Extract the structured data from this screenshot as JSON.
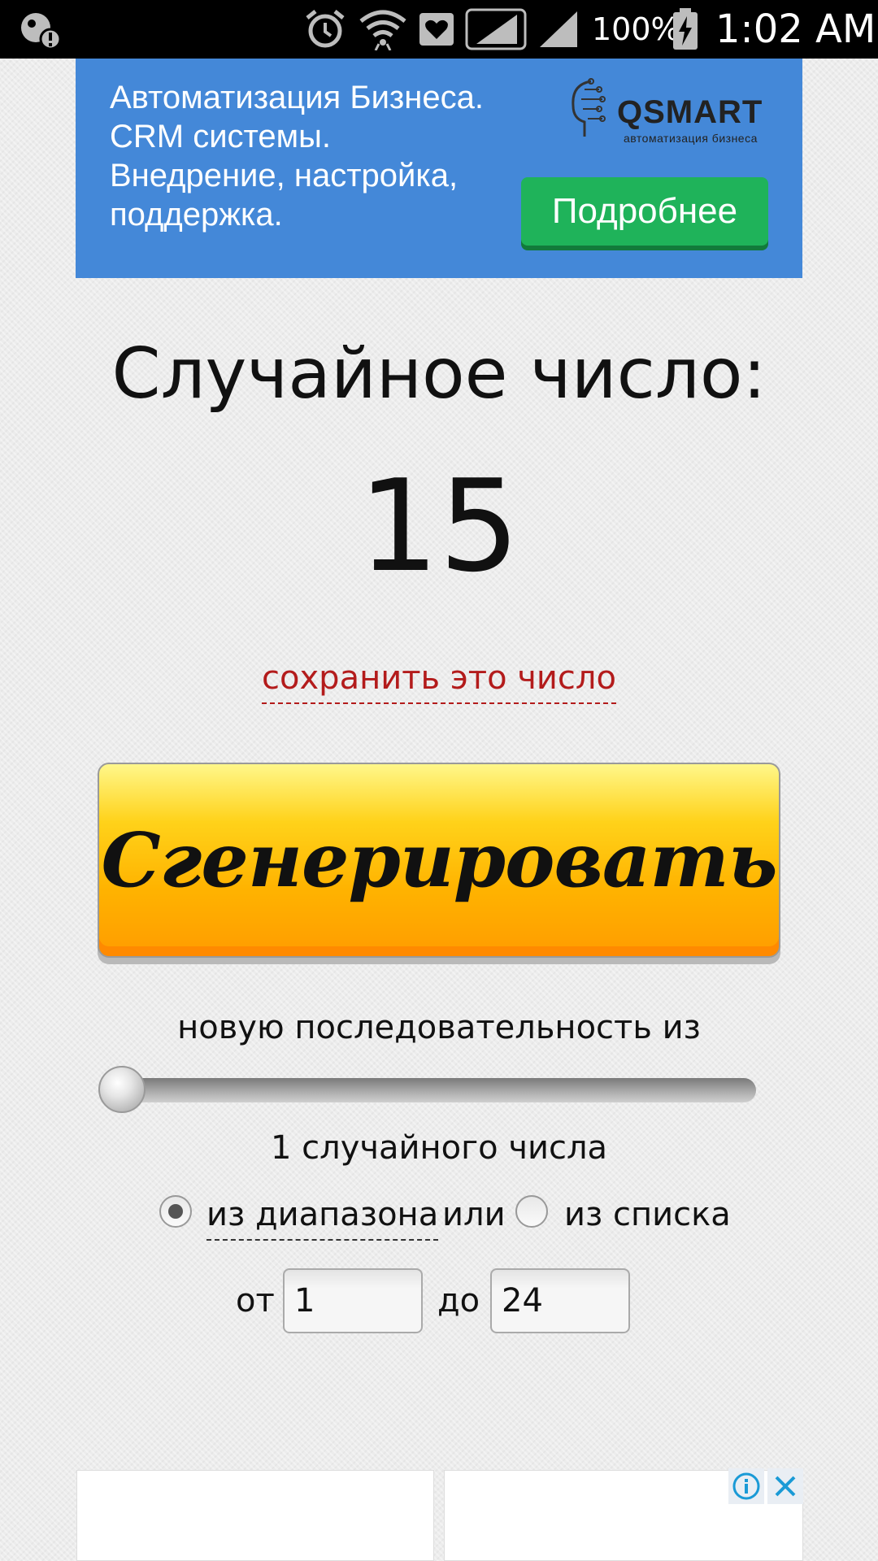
{
  "status_bar": {
    "battery_percent": "100%",
    "time": "1:02 AM",
    "icons": [
      "location-alert-icon",
      "alarm-icon",
      "wifi-icon",
      "health-icon",
      "signal-icon",
      "signal-icon",
      "battery-charging-icon"
    ]
  },
  "ad_banner": {
    "text": "Автоматизация Бизнеса. CRM системы. Внедрение, настройка, поддержка.",
    "logo_name": "QSMART",
    "logo_tagline": "автоматизация бизнеса",
    "cta_label": "Подробнее",
    "background": "#4488d8",
    "cta_color": "#1fb35a"
  },
  "main": {
    "title": "Случайное число:",
    "number": "15",
    "save_link": "сохранить это число",
    "generate_label": "Сгенерировать",
    "sequence_label": "новую последовательность из",
    "slider_value": 1,
    "count_label": "1 случайного числа",
    "mode": {
      "range_label": "из диапазона",
      "or_text": "или",
      "list_label": "из списка",
      "selected": "range"
    },
    "range": {
      "from_label": "от",
      "from_value": "1",
      "to_label": "до",
      "to_value": "24"
    }
  },
  "bottom_ad": {
    "icons": [
      "info-icon",
      "close-icon"
    ]
  },
  "colors": {
    "link": "#b31b1b",
    "generate_button": "#ffb300"
  }
}
